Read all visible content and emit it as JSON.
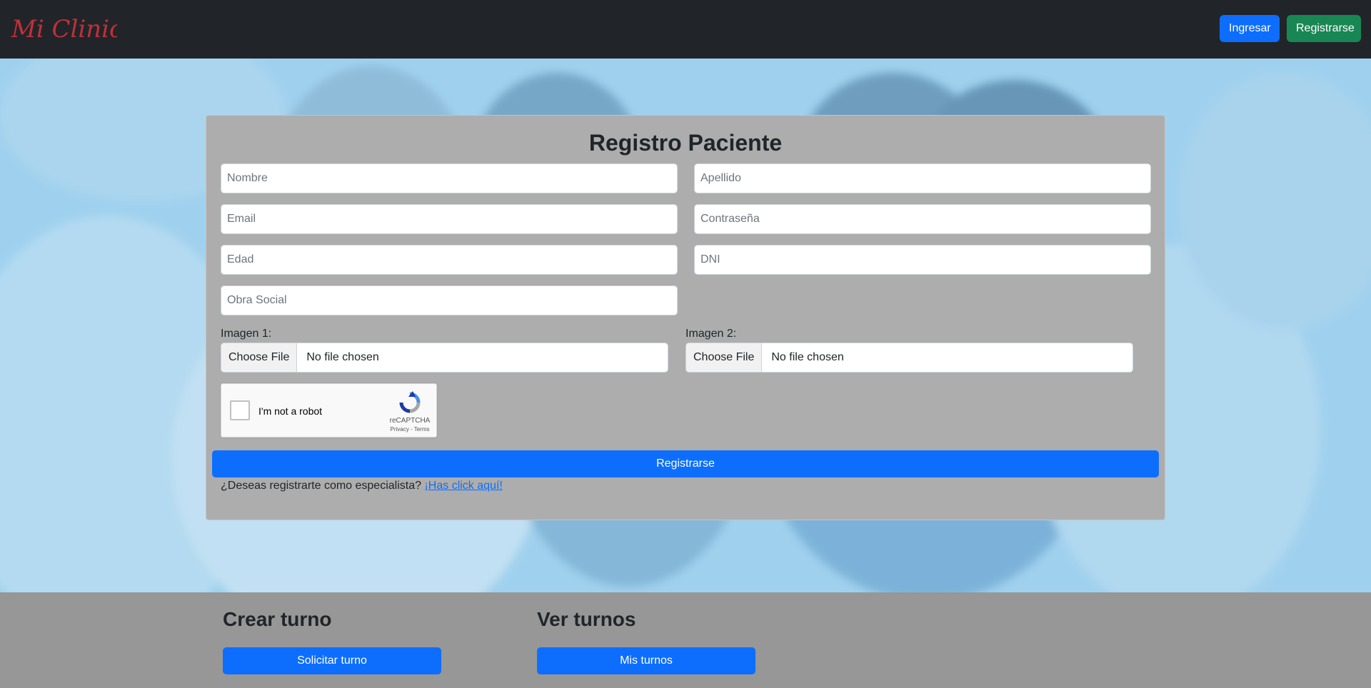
{
  "navbar": {
    "brand": "Mi Clinica",
    "login_label": "Ingresar",
    "register_label": "Registrarse",
    "login_color": "#0d6efd",
    "register_color": "#198754"
  },
  "form": {
    "title": "Registro Paciente",
    "placeholders": {
      "nombre": "Nombre",
      "apellido": "Apellido",
      "email": "Email",
      "password": "Contraseña",
      "edad": "Edad",
      "dni": "DNI",
      "obra_social": "Obra Social"
    },
    "image1_label": "Imagen 1:",
    "image2_label": "Imagen 2:",
    "choose_file": "Choose File",
    "no_file": "No file chosen",
    "captcha": {
      "text": "I'm not a robot",
      "brand": "reCAPTCHA",
      "links": "Privacy - Terms"
    },
    "submit_label": "Registrarse",
    "specialist_question": "¿Deseas registrarte como especialista?",
    "specialist_link": "¡Has click aquí!"
  },
  "bottom": {
    "crear_title": "Crear turno",
    "crear_button": "Solicitar turno",
    "ver_title": "Ver turnos",
    "ver_button": "Mis turnos"
  }
}
